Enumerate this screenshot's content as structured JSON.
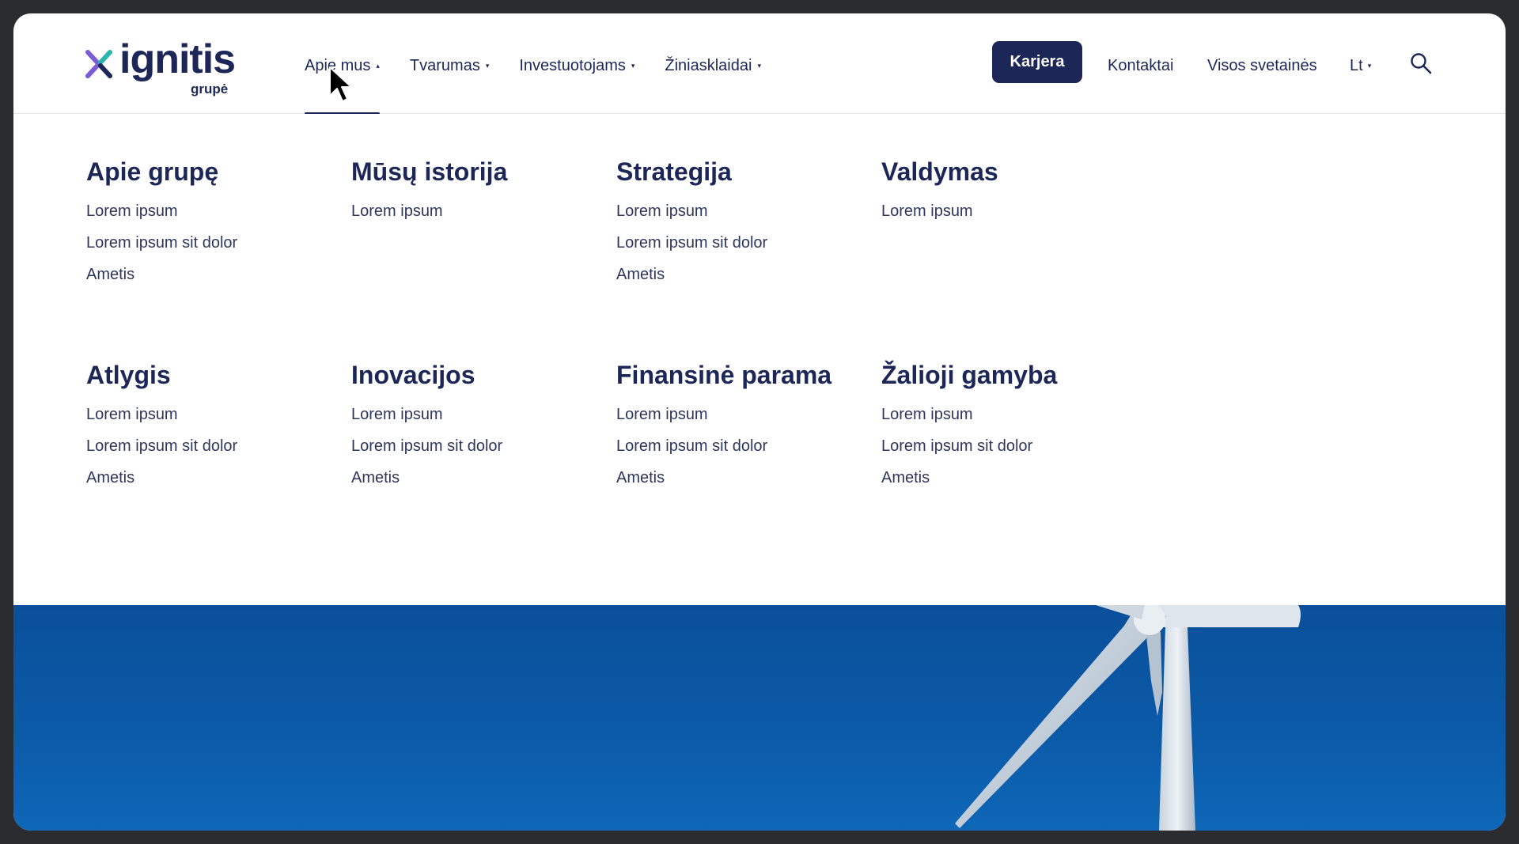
{
  "brand": {
    "name": "ignitis",
    "sub": "grupė",
    "colors": {
      "navy": "#1c2657",
      "teal": "#2bb4b0",
      "violet": "#7b5bd6",
      "sky": "#0b5aa8"
    }
  },
  "nav": {
    "items": [
      {
        "label": "Apie mus",
        "expanded": true
      },
      {
        "label": "Tvarumas",
        "expanded": false
      },
      {
        "label": "Investuotojams",
        "expanded": false
      },
      {
        "label": "Žiniasklaidai",
        "expanded": false
      }
    ],
    "karjera": "Karjera",
    "kontaktai": "Kontaktai",
    "visos": "Visos svetainės",
    "lang": "Lt",
    "icons": {
      "search": "search-icon",
      "caret_up": "▴",
      "caret_down": "▾"
    }
  },
  "menu": {
    "columns": [
      {
        "title": "Apie grupę",
        "links": [
          "Lorem ipsum",
          "Lorem ipsum sit dolor",
          "Ametis"
        ]
      },
      {
        "title": "Mūsų istorija",
        "links": [
          "Lorem ipsum"
        ]
      },
      {
        "title": "Strategija",
        "links": [
          "Lorem ipsum",
          "Lorem ipsum sit dolor",
          "Ametis"
        ]
      },
      {
        "title": "Valdymas",
        "links": [
          "Lorem ipsum"
        ]
      },
      {
        "title": "Atlygis",
        "links": [
          "Lorem ipsum",
          "Lorem ipsum sit dolor",
          "Ametis"
        ]
      },
      {
        "title": "Inovacijos",
        "links": [
          "Lorem ipsum",
          "Lorem ipsum sit dolor",
          "Ametis"
        ]
      },
      {
        "title": "Finansinė parama",
        "links": [
          "Lorem ipsum",
          "Lorem ipsum sit dolor",
          "Ametis"
        ]
      },
      {
        "title": "Žalioji gamyba",
        "links": [
          "Lorem ipsum",
          "Lorem ipsum sit dolor",
          "Ametis"
        ]
      }
    ]
  }
}
